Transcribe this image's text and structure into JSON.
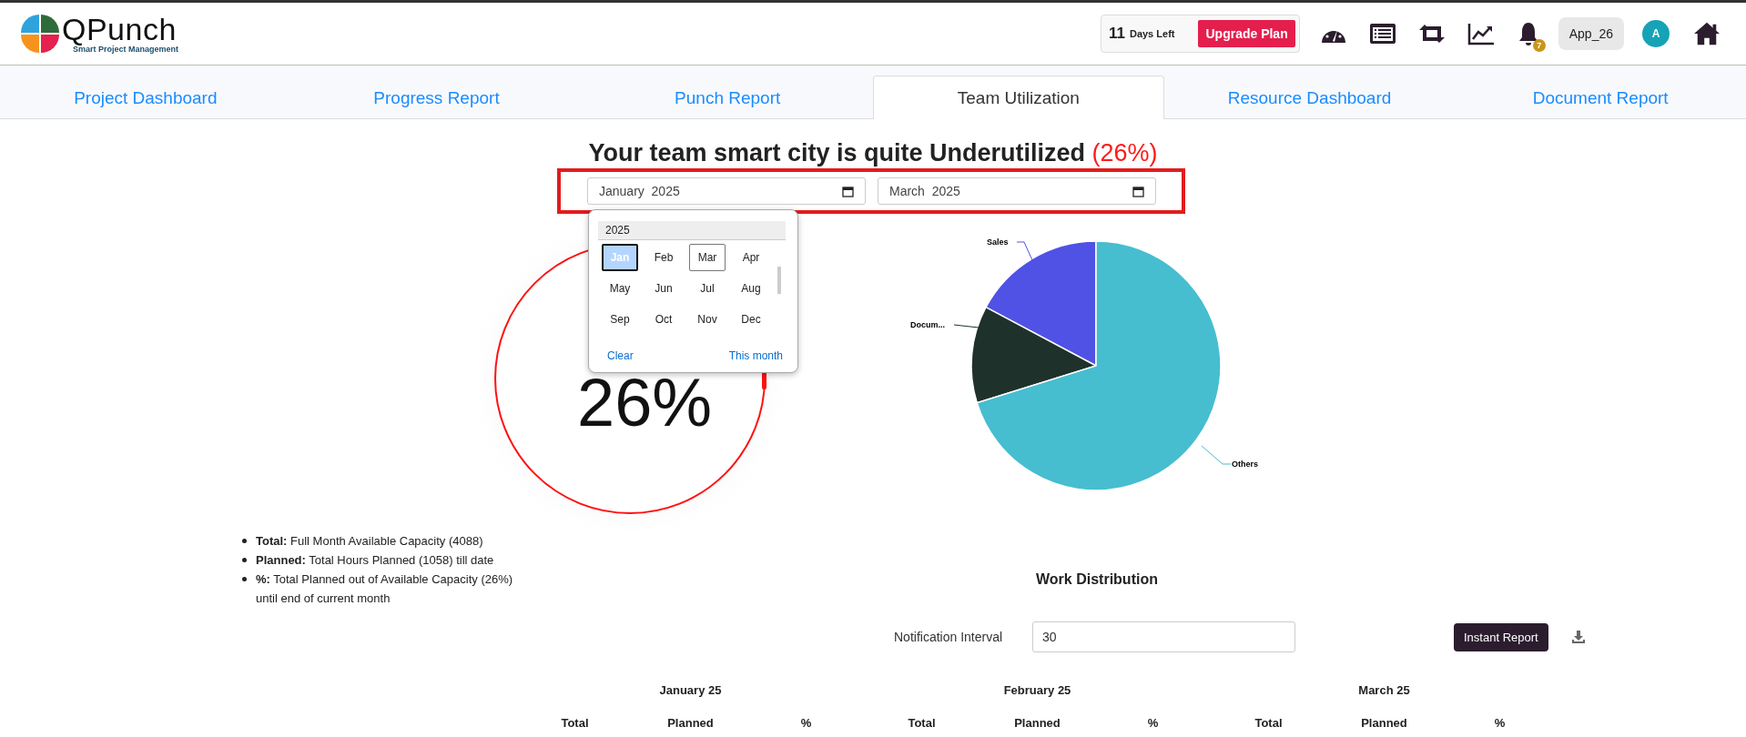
{
  "header": {
    "logo": {
      "name": "QPunch",
      "tagline": "Smart Project Management"
    },
    "trial": {
      "days": "11",
      "label": "Days Left",
      "button": "Upgrade Plan"
    },
    "notifications": {
      "badge": "7"
    },
    "app": "App_26",
    "avatar": "A"
  },
  "tabs": [
    {
      "label": "Project Dashboard",
      "selected": false
    },
    {
      "label": "Progress Report",
      "selected": false
    },
    {
      "label": "Punch Report",
      "selected": false
    },
    {
      "label": "Team Utilization",
      "selected": true
    },
    {
      "label": "Resource Dashboard",
      "selected": false
    },
    {
      "label": "Document Report",
      "selected": false
    }
  ],
  "title": {
    "text": "Your team smart city is quite Underutilized",
    "highlight": "(26%)"
  },
  "date_range": {
    "from": "January  2025",
    "to": "March  2025"
  },
  "month_picker": {
    "year": "2025",
    "months": [
      {
        "label": "Jan",
        "selected": true,
        "current": false
      },
      {
        "label": "Feb",
        "selected": false,
        "current": false
      },
      {
        "label": "Mar",
        "selected": false,
        "current": true
      },
      {
        "label": "Apr",
        "selected": false,
        "current": false
      },
      {
        "label": "May",
        "selected": false,
        "current": false
      },
      {
        "label": "Jun",
        "selected": false,
        "current": false
      },
      {
        "label": "Jul",
        "selected": false,
        "current": false
      },
      {
        "label": "Aug",
        "selected": false,
        "current": false
      },
      {
        "label": "Sep",
        "selected": false,
        "current": false
      },
      {
        "label": "Oct",
        "selected": false,
        "current": false
      },
      {
        "label": "Nov",
        "selected": false,
        "current": false
      },
      {
        "label": "Dec",
        "selected": false,
        "current": false
      }
    ],
    "clear": "Clear",
    "this_month": "This month"
  },
  "gauge": {
    "value": "26%"
  },
  "pie": {
    "slices": [
      {
        "label": "Sales",
        "color": "#5052e5"
      },
      {
        "label": "Docum...",
        "color": "#1f312b"
      },
      {
        "label": "Others",
        "color": "#47bdd0"
      }
    ]
  },
  "legend": [
    "**Total:** Full Month Available Capacity (4088)",
    "**Planned:** Total Hours Planned (1058) till date",
    "**%:** Total Planned out of Available Capacity (26%) until end of current month"
  ],
  "work_distribution": {
    "title": "Work Distribution",
    "notification_label": "Notification Interval",
    "notification_value": "30",
    "button": "Instant Report"
  },
  "table": {
    "groups": [
      {
        "month": "January 25",
        "columns": [
          "Total",
          "Planned",
          "%"
        ]
      },
      {
        "month": "February 25",
        "columns": [
          "Total",
          "Planned",
          "%"
        ]
      },
      {
        "month": "March 25",
        "columns": [
          "Total",
          "Planned",
          "%"
        ]
      }
    ]
  }
}
